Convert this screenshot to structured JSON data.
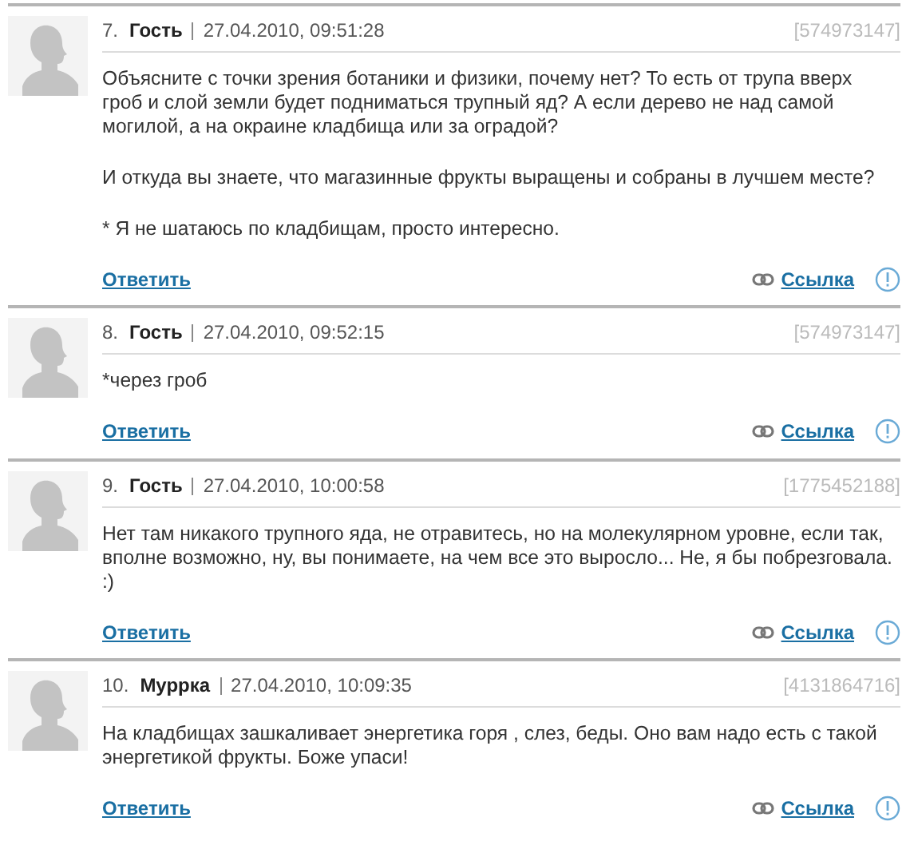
{
  "comments": [
    {
      "number": "7.",
      "author": "Гость",
      "date": "27.04.2010, 09:51:28",
      "id": "[574973147]",
      "paragraphs": [
        "Объясните с точки зрения ботаники и физики, почему нет? То есть от трупа вверх гроб и слой земли будет подниматься трупный яд? А если дерево не над самой могилой, а на окраине кладбища или за оградой?",
        "И откуда вы знаете, что магазинные фрукты выращены и собраны в лучшем месте?",
        "* Я не шатаюсь по кладбищам, просто интересно."
      ],
      "reply": "Ответить",
      "link": "Ссылка"
    },
    {
      "number": "8.",
      "author": "Гость",
      "date": "27.04.2010, 09:52:15",
      "id": "[574973147]",
      "paragraphs": [
        "*через гроб"
      ],
      "reply": "Ответить",
      "link": "Ссылка"
    },
    {
      "number": "9.",
      "author": "Гость",
      "date": "27.04.2010, 10:00:58",
      "id": "[1775452188]",
      "paragraphs": [
        "Нет там никакого трупного яда, не отравитесь, но на молекулярном уровне, если так, вполне возможно, ну, вы понимаете, на чем все это выросло... Не, я бы побрезговала. :)"
      ],
      "reply": "Ответить",
      "link": "Ссылка"
    },
    {
      "number": "10.",
      "author": "Муррка",
      "date": "27.04.2010, 10:09:35",
      "id": "[4131864716]",
      "paragraphs": [
        "На кладбищах зашкаливает энергетика горя , слез, беды. Оно вам надо есть с такой энергетикой фрукты. Боже упаси!"
      ],
      "reply": "Ответить",
      "link": "Ссылка"
    }
  ]
}
